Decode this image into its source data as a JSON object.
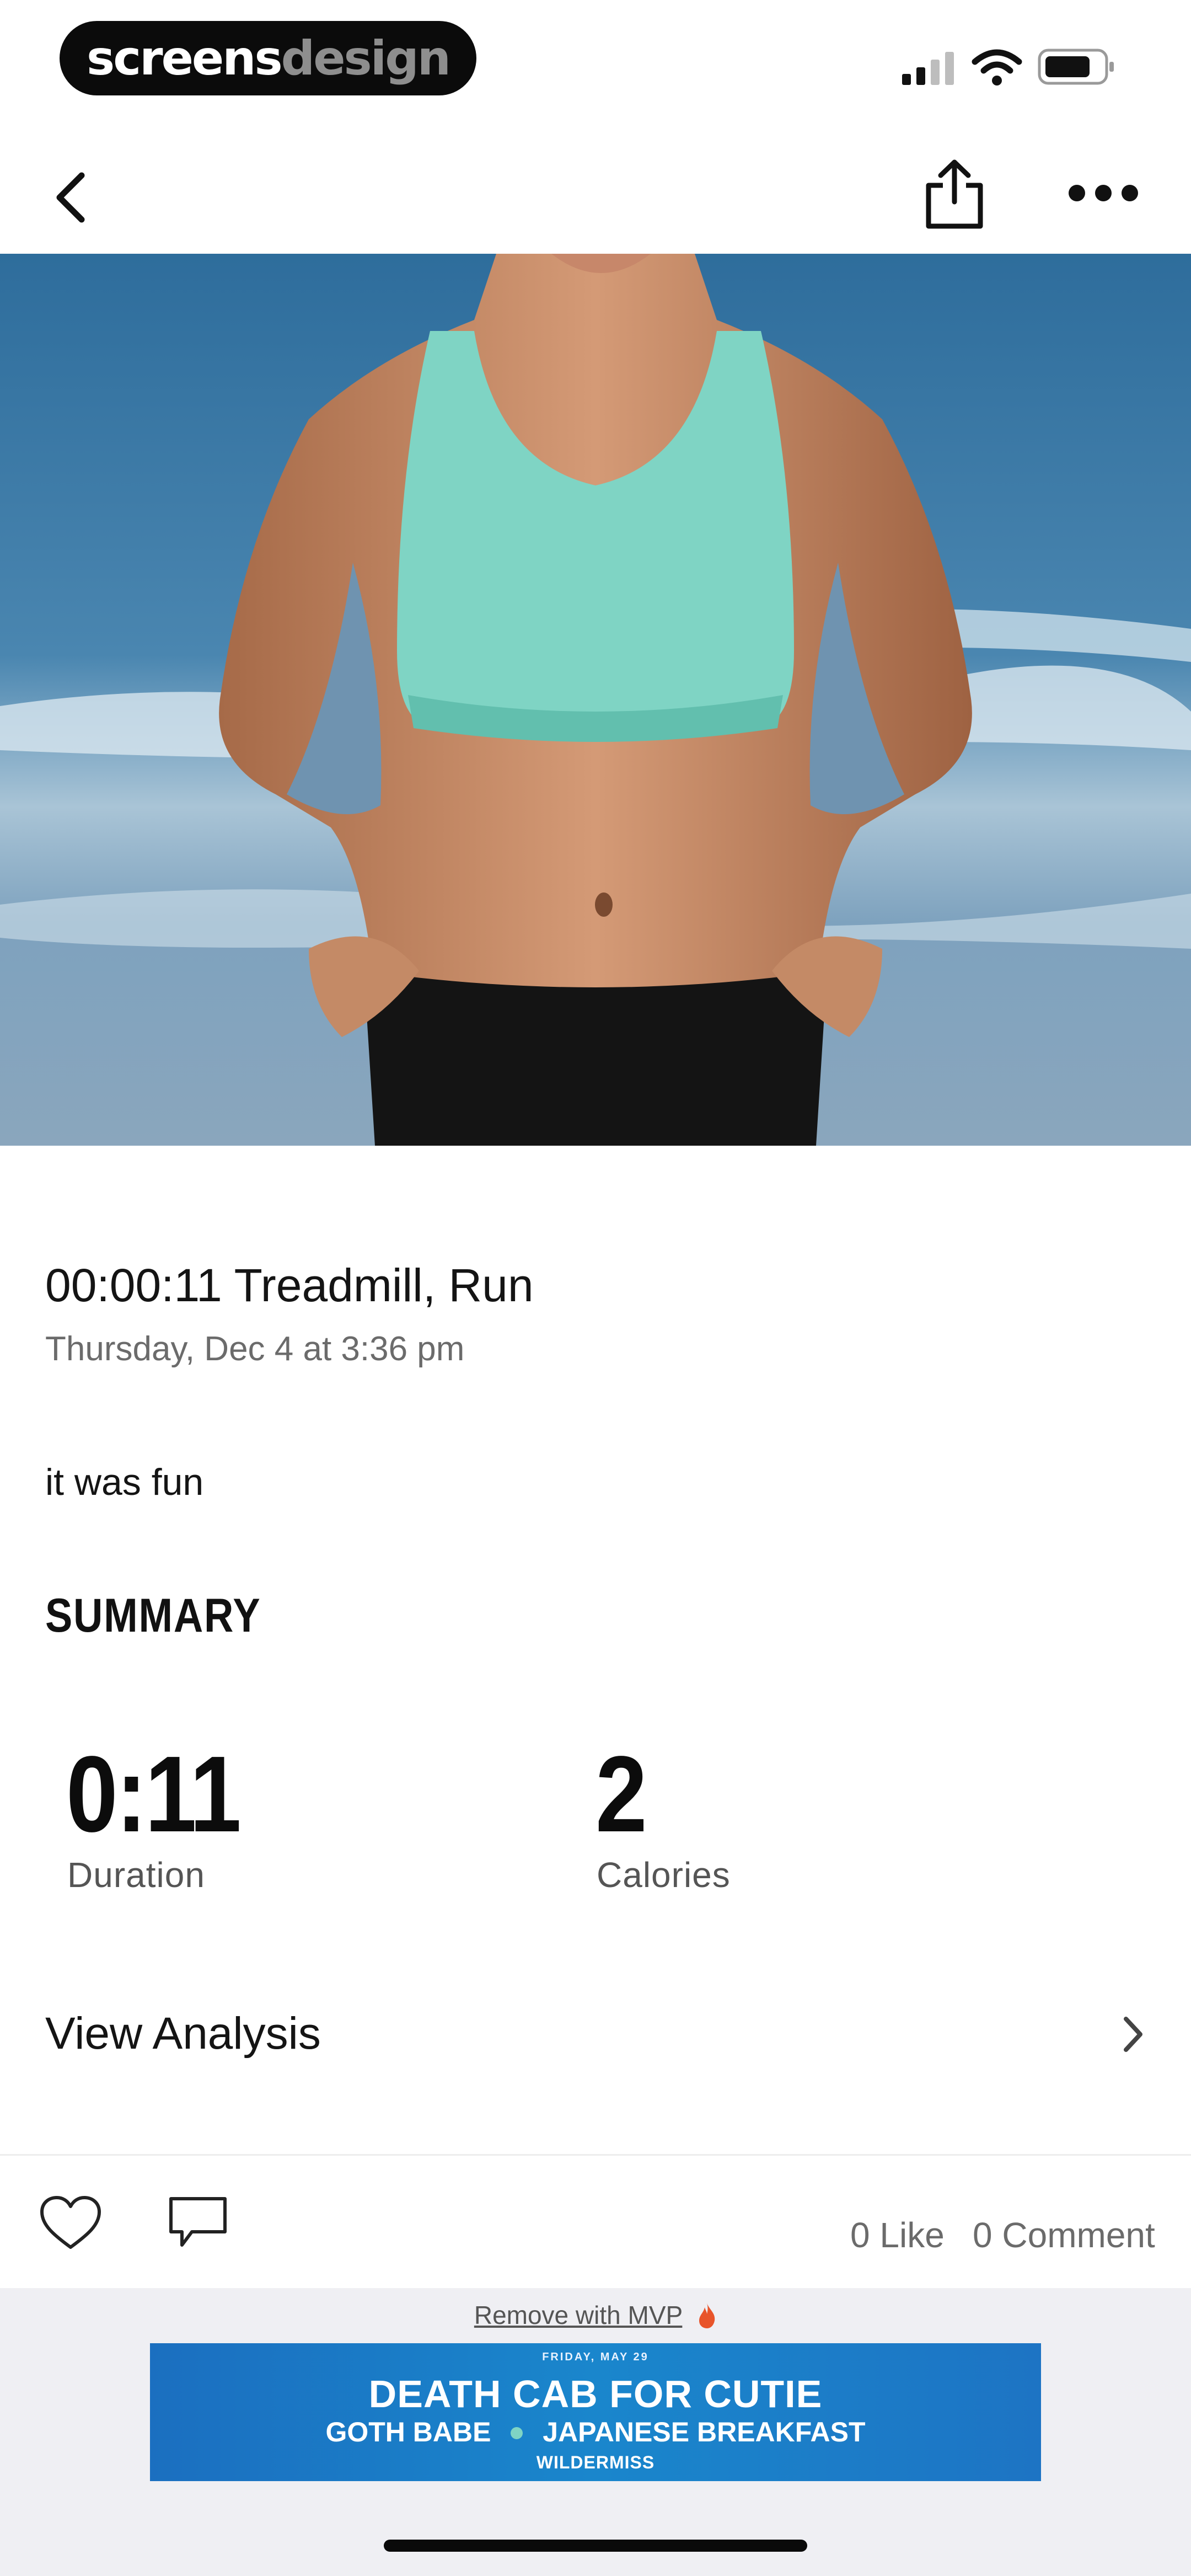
{
  "status_bar": {
    "brand_part1": "screens",
    "brand_part2": "design",
    "signal_icon": "signal-bars-icon",
    "wifi_icon": "wifi-icon",
    "battery_icon": "battery-icon"
  },
  "nav": {
    "back_icon": "chevron-left-icon",
    "share_icon": "share-icon",
    "more_icon": "ellipsis-icon"
  },
  "activity": {
    "title": "00:00:11 Treadmill, Run",
    "date": "Thursday, Dec 4 at 3:36 pm",
    "note": "it was fun"
  },
  "summary": {
    "heading": "SUMMARY",
    "stats": [
      {
        "value": "0:11",
        "label": "Duration"
      },
      {
        "value": "2",
        "label": "Calories"
      }
    ]
  },
  "analysis": {
    "label": "View Analysis",
    "chevron_icon": "chevron-right-icon"
  },
  "actions": {
    "like_icon": "heart-icon",
    "comment_icon": "comment-icon",
    "likes": "0 Like",
    "comments": "0 Comment"
  },
  "ad": {
    "remove_label": "Remove with MVP",
    "date": "FRIDAY, MAY 29",
    "headline": "DEATH CAB FOR CUTIE",
    "support_1": "GOTH BABE",
    "support_2": "JAPANESE BREAKFAST",
    "footer": "WILDERMISS"
  },
  "colors": {
    "accent_orange": "#e8542a",
    "ad_blue": "#1a86cc",
    "top_teal": "#7fd4c4"
  }
}
